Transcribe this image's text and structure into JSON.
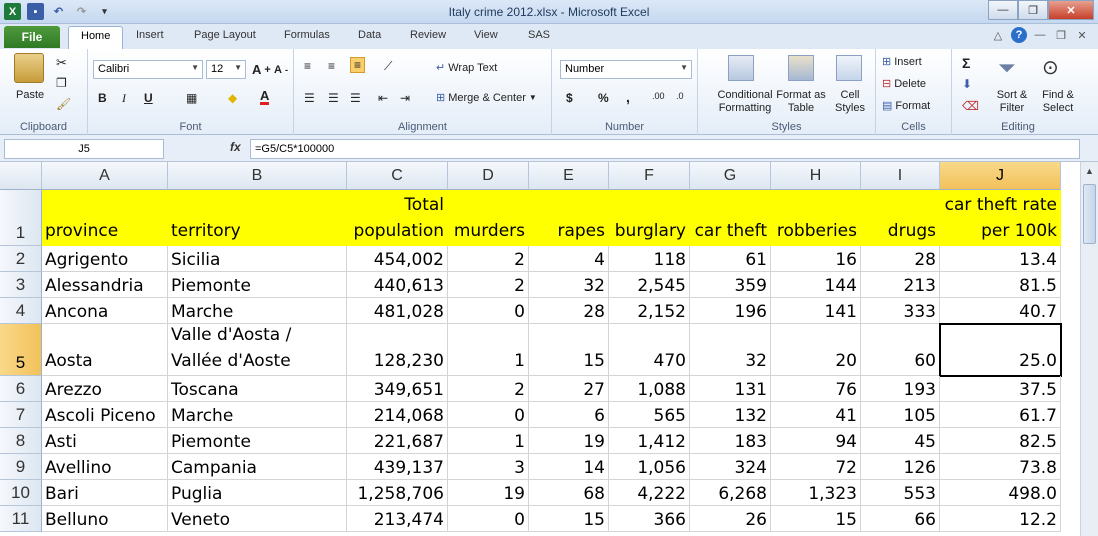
{
  "window": {
    "title": "Italy crime 2012.xlsx - Microsoft Excel"
  },
  "tabs": {
    "file": "File",
    "items": [
      "Home",
      "Insert",
      "Page Layout",
      "Formulas",
      "Data",
      "Review",
      "View",
      "SAS"
    ]
  },
  "ribbon": {
    "clipboard": {
      "label": "Clipboard",
      "paste": "Paste"
    },
    "font": {
      "label": "Font",
      "name": "Calibri",
      "size": "12",
      "bold": "B",
      "italic": "I",
      "underline": "U"
    },
    "alignment": {
      "label": "Alignment",
      "wrap": "Wrap Text",
      "merge": "Merge & Center"
    },
    "number": {
      "label": "Number",
      "format": "Number",
      "currency": "$",
      "percent": "%",
      "comma": ","
    },
    "styles": {
      "label": "Styles",
      "conditional": "Conditional Formatting",
      "format_table": "Format as Table",
      "cell_styles": "Cell Styles"
    },
    "cells": {
      "label": "Cells",
      "insert": "Insert",
      "delete": "Delete",
      "format": "Format"
    },
    "editing": {
      "label": "Editing",
      "sort": "Sort & Filter",
      "find": "Find & Select"
    }
  },
  "formula": {
    "namebox": "J5",
    "fx": "fx",
    "content": "=G5/C5*100000"
  },
  "columns": [
    "A",
    "B",
    "C",
    "D",
    "E",
    "F",
    "G",
    "H",
    "I",
    "J"
  ],
  "header_row": [
    "province",
    "territory",
    "Total population",
    "murders",
    "rapes",
    "burglary",
    "car theft",
    "robberies",
    "drugs",
    "car theft rate per 100k"
  ],
  "rows": [
    {
      "n": "2",
      "cells": [
        "Agrigento",
        "Sicilia",
        "454,002",
        "2",
        "4",
        "118",
        "61",
        "16",
        "28",
        "13.4"
      ]
    },
    {
      "n": "3",
      "cells": [
        "Alessandria",
        "Piemonte",
        "440,613",
        "2",
        "32",
        "2,545",
        "359",
        "144",
        "213",
        "81.5"
      ]
    },
    {
      "n": "4",
      "cells": [
        "Ancona",
        "Marche",
        "481,028",
        "0",
        "28",
        "2,152",
        "196",
        "141",
        "333",
        "40.7"
      ]
    },
    {
      "n": "5",
      "cells": [
        "Aosta",
        "Valle d'Aosta / Vallée d'Aoste",
        "128,230",
        "1",
        "15",
        "470",
        "32",
        "20",
        "60",
        "25.0"
      ]
    },
    {
      "n": "6",
      "cells": [
        "Arezzo",
        "Toscana",
        "349,651",
        "2",
        "27",
        "1,088",
        "131",
        "76",
        "193",
        "37.5"
      ]
    },
    {
      "n": "7",
      "cells": [
        "Ascoli Piceno",
        "Marche",
        "214,068",
        "0",
        "6",
        "565",
        "132",
        "41",
        "105",
        "61.7"
      ]
    },
    {
      "n": "8",
      "cells": [
        "Asti",
        "Piemonte",
        "221,687",
        "1",
        "19",
        "1,412",
        "183",
        "94",
        "45",
        "82.5"
      ]
    },
    {
      "n": "9",
      "cells": [
        "Avellino",
        "Campania",
        "439,137",
        "3",
        "14",
        "1,056",
        "324",
        "72",
        "126",
        "73.8"
      ]
    },
    {
      "n": "10",
      "cells": [
        "Bari",
        "Puglia",
        "1,258,706",
        "19",
        "68",
        "4,222",
        "6,268",
        "1,323",
        "553",
        "498.0"
      ]
    },
    {
      "n": "11",
      "cells": [
        "Belluno",
        "Veneto",
        "213,474",
        "0",
        "15",
        "366",
        "26",
        "15",
        "66",
        "12.2"
      ]
    }
  ]
}
